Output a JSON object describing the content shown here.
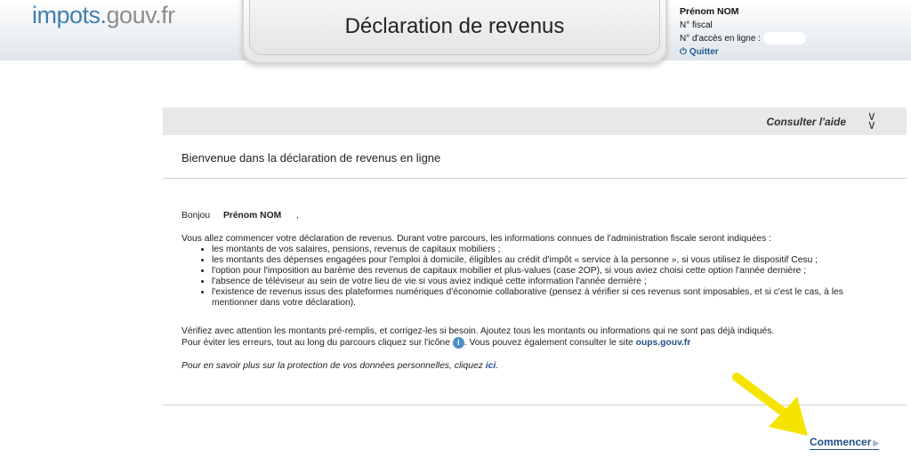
{
  "header": {
    "logo_part1": "impots.",
    "logo_part2": "gouv.fr",
    "title": "Déclaration de revenus",
    "user_name": "Prénom NOM",
    "fiscal_label": "N° fiscal",
    "access_label": "N° d'accès en ligne :",
    "quit_label": "Quitter"
  },
  "help": {
    "label": "Consulter l'aide",
    "chevron_icon": "double-chevron-down-icon"
  },
  "welcome": "Bienvenue dans la déclaration de revenus en ligne",
  "content": {
    "greeting": "Bonjou",
    "greeting_name": "Prénom NOM",
    "greeting_suffix": ",",
    "intro": "Vous allez commencer votre déclaration de revenus. Durant votre parcours, les informations connues de l'administration fiscale seront indiquées :",
    "bullets": [
      "les montants de vos salaires, pensions, revenus de capitaux mobiliers ;",
      "les montants des dépenses engagées pour l'emploi à domicile, éligibles au crédit d'impôt « service à la personne », si vous utilisez le dispositif Cesu ;",
      "l'option pour l'imposition au barème des revenus de capitaux mobilier et plus-values (case 2OP), si vous aviez choisi cette option l'année dernière ;",
      "l'absence de téléviseur au sein de votre lieu de vie si vous aviez indiqué cette information l'année dernière ;",
      "l'existence de revenus issus des plateformes numériques d'économie collaborative (pensez à vérifier si ces revenus sont imposables, et si c'est le cas, à les mentionner dans votre déclaration)."
    ],
    "verify": "Vérifiez avec attention les montants pré-remplis, et corrigez-les si besoin. Ajoutez tous les montants ou informations qui ne sont pas déjà indiqués.",
    "errors_prefix": "Pour éviter les erreurs, tout au long du parcours cliquez sur l'icône",
    "errors_middle": ". Vous pouvez également consulter le site",
    "oups_link": "oups.gouv.fr",
    "privacy_prefix": "Pour en savoir plus sur la protection de vos données personnelles, cliquez",
    "privacy_link": "ici",
    "privacy_suffix": "."
  },
  "start_label": "Commencer",
  "colors": {
    "brand_blue": "#3f7fb0",
    "link_blue": "#1f4f86",
    "annotation_yellow": "#f5e400"
  }
}
